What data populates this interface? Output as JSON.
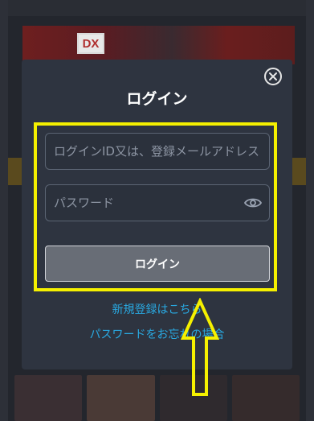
{
  "background": {
    "banner_badge": "DX"
  },
  "modal": {
    "title": "ログイン",
    "close_icon": "close-circle-icon",
    "id_field": {
      "placeholder": "ログインID又は、登録メールアドレス",
      "value": ""
    },
    "password_field": {
      "placeholder": "パスワード",
      "value": "",
      "toggle_icon": "eye-icon"
    },
    "login_button_label": "ログイン",
    "register_link": "新規登録はこちら",
    "forgot_link": "パスワードをお忘れの場合"
  },
  "annotations": {
    "highlight_color": "#f5f000",
    "arrow_icon": "up-arrow-icon"
  },
  "colors": {
    "modal_bg": "#2e3440",
    "link": "#29a8e0",
    "button_bg": "#686d76"
  }
}
